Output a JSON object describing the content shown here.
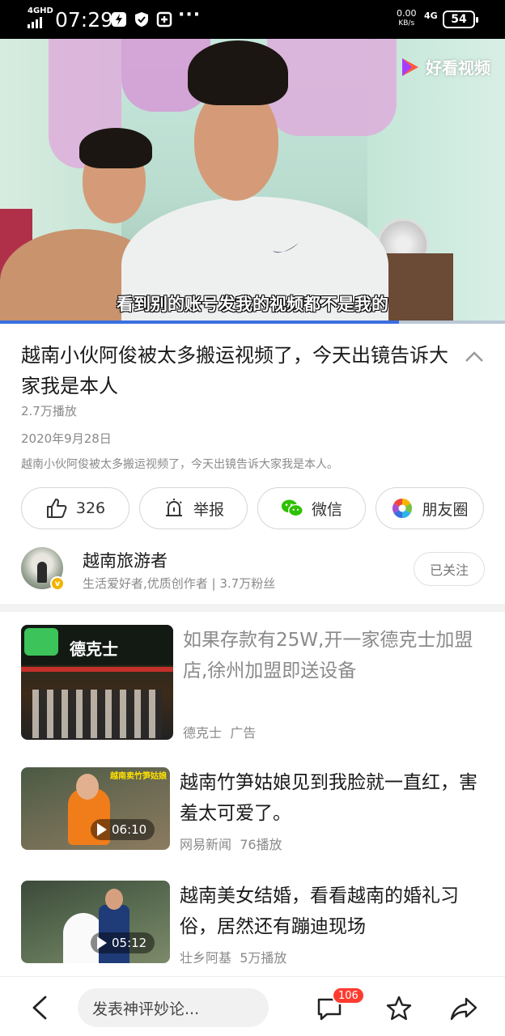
{
  "status_bar": {
    "network": "4GHD",
    "time": "07:29",
    "speed_value": "0.00",
    "speed_unit": "KB/s",
    "network_right": "4G",
    "battery": "54",
    "more": "···"
  },
  "video": {
    "brand": "好看视频",
    "subtitle": "看到别的账号发我的视频都不是我的",
    "progress_fraction": 0.79
  },
  "detail": {
    "title": "越南小伙阿俊被太多搬运视频了，今天出镜告诉大家我是本人",
    "plays": "2.7万播放",
    "date": "2020年9月28日",
    "description": "越南小伙阿俊被太多搬运视频了，今天出镜告诉大家我是本人。"
  },
  "actions": {
    "like": "326",
    "report": "举报",
    "wechat": "微信",
    "moments": "朋友圈"
  },
  "author": {
    "name": "越南旅游者",
    "meta": "生活爱好者,优质创作者 | 3.7万粉丝",
    "follow": "已关注",
    "verified_mark": "v"
  },
  "feed": [
    {
      "title": "如果存款有25W,开一家德克士加盟店,徐州加盟即送设备",
      "source": "德克士",
      "tag": "广告",
      "thumb_text": "德克士"
    },
    {
      "title": "越南竹笋姑娘见到我脸就一直红，害羞太可爱了。",
      "source": "网易新闻",
      "plays": "76播放",
      "duration": "06:10",
      "thumb_text": "越南卖竹笋姑娘"
    },
    {
      "title": "越南美女结婚，看看越南的婚礼习俗，居然还有蹦迪现场",
      "source": "壮乡阿基",
      "plays": "5万播放",
      "duration": "05:12"
    }
  ],
  "bottom_bar": {
    "comment_placeholder": "发表神评妙论...",
    "comment_count": "106"
  }
}
